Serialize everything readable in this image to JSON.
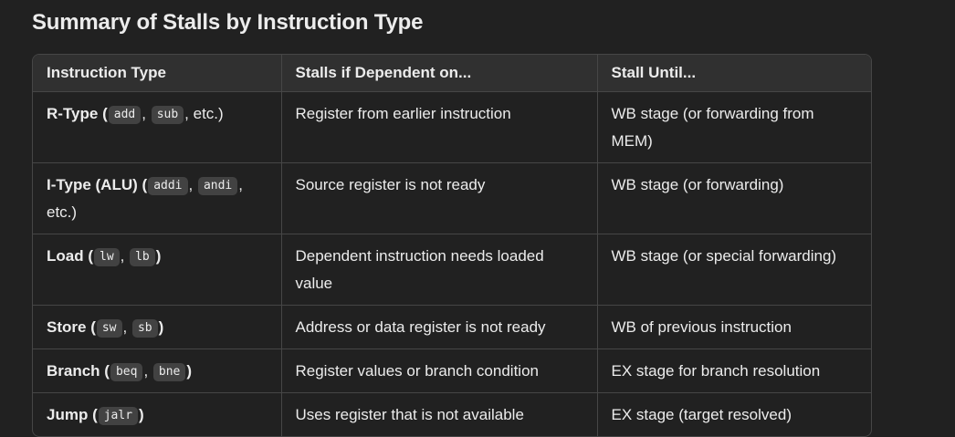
{
  "heading": "Summary of Stalls by Instruction Type",
  "table": {
    "headers": [
      "Instruction Type",
      "Stalls if Dependent on...",
      "Stall Until..."
    ],
    "rows": [
      {
        "type_name": "R-Type",
        "codes": [
          "add",
          "sub"
        ],
        "trail_text": ", etc.)",
        "stalls": "Register from earlier instruction",
        "until": "WB stage (or forwarding from MEM)"
      },
      {
        "type_name": "I-Type (ALU)",
        "codes": [
          "addi",
          "andi"
        ],
        "trail_text": ", etc.)",
        "stalls": "Source register is not ready",
        "until": "WB stage (or forwarding)"
      },
      {
        "type_name": "Load",
        "codes": [
          "lw",
          "lb"
        ],
        "trail_text": ")",
        "stalls": "Dependent instruction needs loaded value",
        "until": "WB stage (or special forwarding)"
      },
      {
        "type_name": "Store",
        "codes": [
          "sw",
          "sb"
        ],
        "trail_text": ")",
        "stalls": "Address or data register is not ready",
        "until": "WB of previous instruction"
      },
      {
        "type_name": "Branch",
        "codes": [
          "beq",
          "bne"
        ],
        "trail_text": ")",
        "stalls": "Register values or branch condition",
        "until": "EX stage for branch resolution"
      },
      {
        "type_name": "Jump",
        "codes": [
          "jalr"
        ],
        "trail_text": ")",
        "stalls": "Uses register that is not available",
        "until": "EX stage (target resolved)"
      }
    ]
  },
  "punct": {
    "open": " (",
    "sep": ", "
  }
}
